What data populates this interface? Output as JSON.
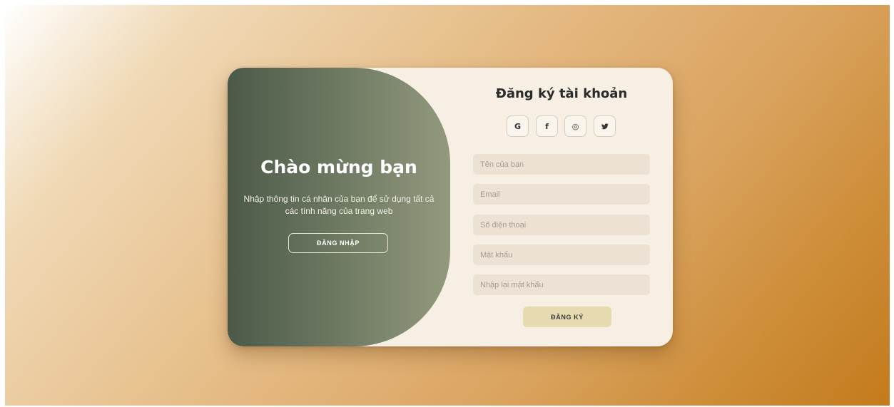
{
  "welcome": {
    "title": "Chào mừng bạn",
    "description": "Nhập thông tin cá nhân của bạn để sử dụng tất cả các tính năng của trang web",
    "login_button_label": "ĐĂNG NHẬP"
  },
  "register": {
    "title": "Đăng ký tài khoản",
    "social": [
      {
        "icon": "google-icon",
        "glyph": "G"
      },
      {
        "icon": "facebook-icon",
        "glyph": "f"
      },
      {
        "icon": "instagram-icon",
        "glyph": "◎"
      },
      {
        "icon": "twitter-icon",
        "glyph": "t"
      }
    ],
    "fields": {
      "name_placeholder": "Tên của bạn",
      "email_placeholder": "Email",
      "phone_placeholder": "Số điện thoại",
      "password_placeholder": "Mật khẩu",
      "confirm_password_placeholder": "Nhập lại mật khẩu"
    },
    "submit_button_label": "ĐĂNG KÝ"
  },
  "colors": {
    "welcome_panel": "#6b7660",
    "card_background": "#f7efe4",
    "input_background": "#ece1d3",
    "submit_button": "#e6dbb0",
    "page_gradient_end": "#c47a1c"
  }
}
